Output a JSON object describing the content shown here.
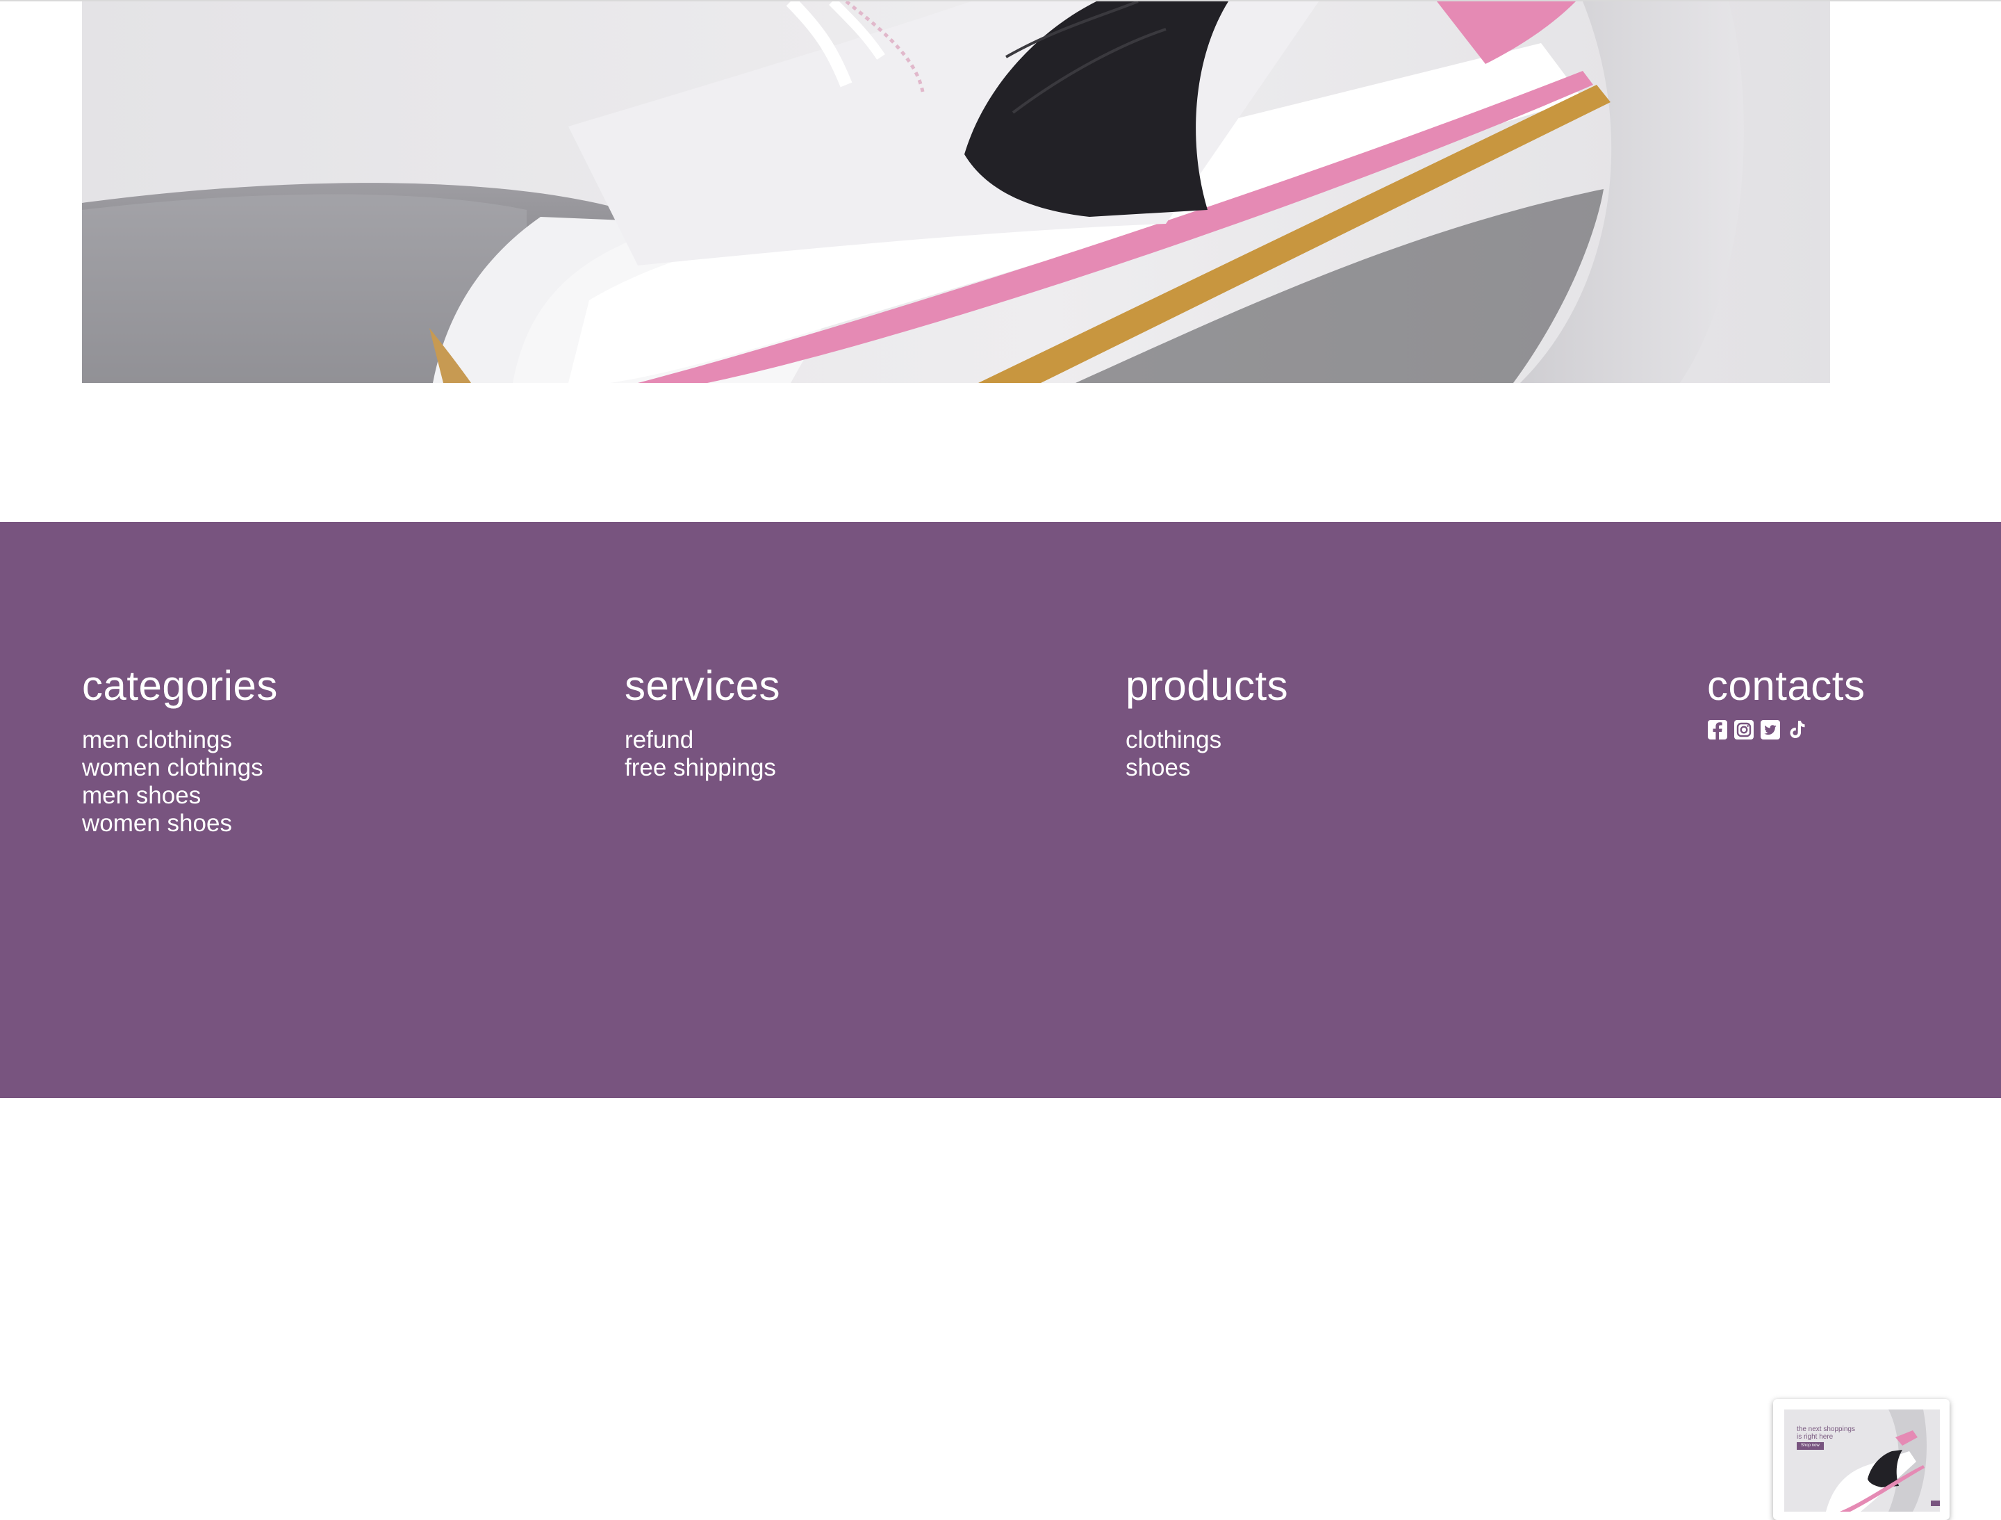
{
  "hero": {
    "image": "sneaker-photo"
  },
  "footer": {
    "categories": {
      "title": "categories",
      "items": [
        "men clothings",
        "women clothings",
        "men shoes",
        "women shoes"
      ]
    },
    "services": {
      "title": "services",
      "items": [
        "refund",
        "free shippings"
      ]
    },
    "products": {
      "title": "products",
      "items": [
        "clothings",
        "shoes"
      ]
    },
    "contacts": {
      "title": "contacts",
      "icons": [
        "facebook-icon",
        "instagram-icon",
        "twitter-icon",
        "tiktok-icon"
      ]
    }
  },
  "preview": {
    "line1": "the next shoppings",
    "line2": "is right here",
    "button": "Shop now"
  },
  "colors": {
    "footer_bg": "#78547f",
    "accent_pink": "#e58ab4"
  }
}
